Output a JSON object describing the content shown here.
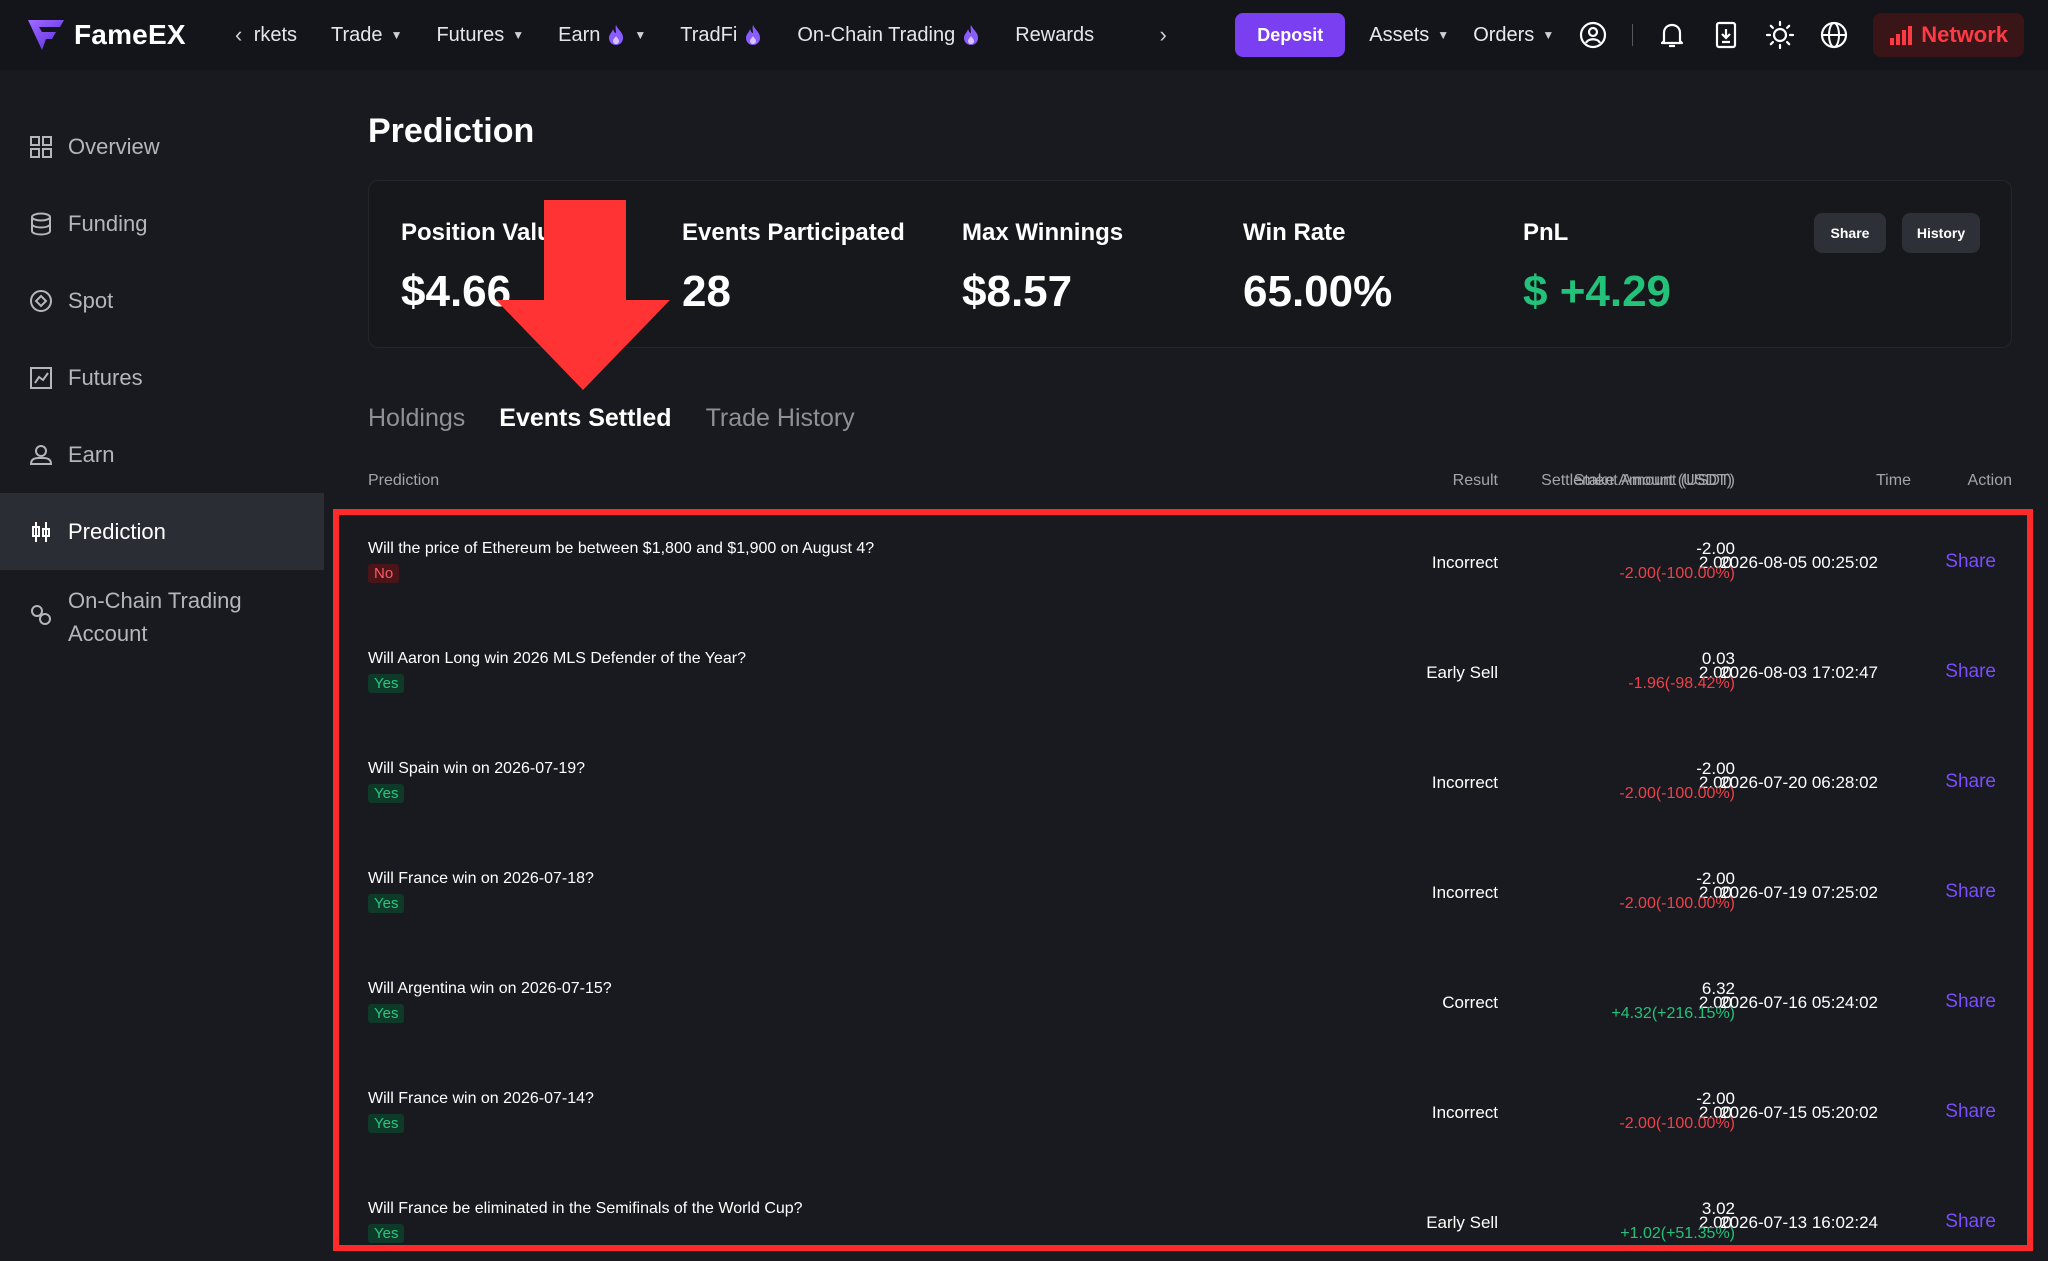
{
  "brand": {
    "name": "FameEX",
    "accent": "#7b3ff2",
    "positive": "#22c27a",
    "negative": "#f04049"
  },
  "nav": {
    "items": [
      {
        "label": "rkets",
        "caret": false,
        "flame": false
      },
      {
        "label": "Trade",
        "caret": true,
        "flame": false
      },
      {
        "label": "Futures",
        "caret": true,
        "flame": false
      },
      {
        "label": "Earn",
        "caret": true,
        "flame": true
      },
      {
        "label": "TradFi",
        "caret": false,
        "flame": true
      },
      {
        "label": "On-Chain Trading",
        "caret": false,
        "flame": true
      },
      {
        "label": "Rewards",
        "caret": false,
        "flame": false
      }
    ],
    "deposit": "Deposit",
    "assets": "Assets",
    "orders": "Orders",
    "network": "Network",
    "icons": [
      "back-icon",
      "forward-icon",
      "user-icon",
      "bell-icon",
      "download-icon",
      "theme-icon",
      "globe-icon",
      "signal-icon"
    ]
  },
  "sidebar": {
    "items": [
      {
        "label": "Overview",
        "icon": "overview-icon"
      },
      {
        "label": "Funding",
        "icon": "funding-icon"
      },
      {
        "label": "Spot",
        "icon": "spot-icon"
      },
      {
        "label": "Futures",
        "icon": "futures-icon"
      },
      {
        "label": "Earn",
        "icon": "earn-icon"
      },
      {
        "label": "Prediction",
        "icon": "prediction-icon",
        "active": true
      },
      {
        "label": "On-Chain Trading\nAccount",
        "icon": "onchain-icon"
      }
    ]
  },
  "page": {
    "title": "Prediction"
  },
  "stats": {
    "position_value": {
      "label": "Position Valu",
      "value": "$4.66"
    },
    "events_participated": {
      "label": "Events Participated",
      "value": "28"
    },
    "max_winnings": {
      "label": "Max Winnings",
      "value": "$8.57"
    },
    "win_rate": {
      "label": "Win Rate",
      "value": "65.00%"
    },
    "pnl": {
      "label": "PnL",
      "value": "$ +4.29"
    },
    "share_btn": "Share",
    "history_btn": "History"
  },
  "tabs": [
    {
      "label": "Holdings",
      "active": false
    },
    {
      "label": "Events Settled",
      "active": true
    },
    {
      "label": "Trade History",
      "active": false
    }
  ],
  "table": {
    "headers": {
      "prediction": "Prediction",
      "result": "Result",
      "stake": "Stake Amount (USDT)",
      "settlement": "Settlement Amount (USDT)",
      "time": "Time",
      "action": "Action"
    },
    "rows": [
      {
        "question": "Will the price of Ethereum be between $1,800 and $1,900 on August 4?",
        "side": "No",
        "result": "Incorrect",
        "stake": "2.00",
        "amount": "-2.00",
        "change": "-2.00(-100.00%)",
        "change_sign": "neg",
        "time": "2026-08-05 00:25:02",
        "action": "Share"
      },
      {
        "question": "Will Aaron Long win 2026 MLS Defender of the Year?",
        "side": "Yes",
        "result": "Early Sell",
        "stake": "2.00",
        "amount": "0.03",
        "change": "-1.96(-98.42%)",
        "change_sign": "neg",
        "time": "2026-08-03 17:02:47",
        "action": "Share"
      },
      {
        "question": "Will Spain win on 2026-07-19?",
        "side": "Yes",
        "result": "Incorrect",
        "stake": "2.00",
        "amount": "-2.00",
        "change": "-2.00(-100.00%)",
        "change_sign": "neg",
        "time": "2026-07-20 06:28:02",
        "action": "Share"
      },
      {
        "question": "Will France win on 2026-07-18?",
        "side": "Yes",
        "result": "Incorrect",
        "stake": "2.00",
        "amount": "-2.00",
        "change": "-2.00(-100.00%)",
        "change_sign": "neg",
        "time": "2026-07-19 07:25:02",
        "action": "Share"
      },
      {
        "question": "Will Argentina win on 2026-07-15?",
        "side": "Yes",
        "result": "Correct",
        "stake": "2.00",
        "amount": "6.32",
        "change": "+4.32(+216.15%)",
        "change_sign": "pos",
        "time": "2026-07-16 05:24:02",
        "action": "Share"
      },
      {
        "question": "Will France win on 2026-07-14?",
        "side": "Yes",
        "result": "Incorrect",
        "stake": "2.00",
        "amount": "-2.00",
        "change": "-2.00(-100.00%)",
        "change_sign": "neg",
        "time": "2026-07-15 05:20:02",
        "action": "Share"
      },
      {
        "question": "Will France be eliminated in the Semifinals of the World Cup?",
        "side": "Yes",
        "result": "Early Sell",
        "stake": "2.00",
        "amount": "3.02",
        "change": "+1.02(+51.35%)",
        "change_sign": "pos",
        "time": "2026-07-13 16:02:24",
        "action": "Share"
      }
    ]
  },
  "annotation": {
    "highlight_color": "#ff2a2a"
  }
}
